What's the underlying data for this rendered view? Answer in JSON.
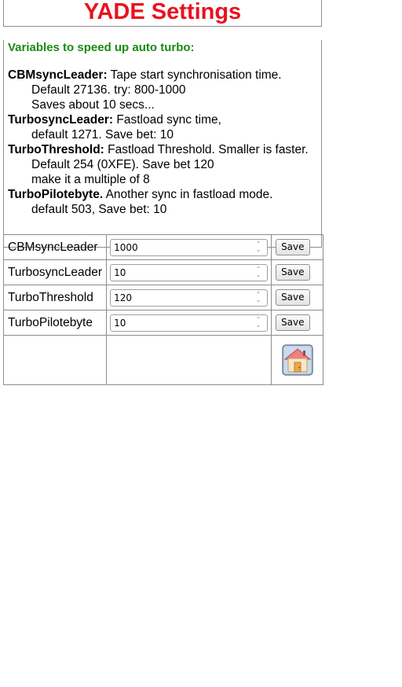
{
  "title": "YADE Settings",
  "subtitle": "Variables to speed up auto turbo:",
  "descriptions": [
    {
      "name": "CBMsyncLeader:",
      "text": " Tape start synchronisation time.",
      "lines": [
        "Default 27136. try: 800-1000",
        "Saves about 10 secs..."
      ]
    },
    {
      "name": "TurbosyncLeader:",
      "text": " Fastload sync time,",
      "lines": [
        "default 1271. Save bet: 10"
      ]
    },
    {
      "name": "TurboThreshold:",
      "text": " Fastload Threshold. Smaller is faster.",
      "lines": [
        "Default 254 (0XFE). Save bet 120",
        "make it a multiple of 8"
      ]
    },
    {
      "name": "TurboPilotebyte.",
      "text": " Another sync in fastload mode.",
      "lines": [
        "default 503, Save bet: 10"
      ]
    }
  ],
  "params": [
    {
      "label": "CBMsyncLeader",
      "value": "1000",
      "button": "Save"
    },
    {
      "label": "TurbosyncLeader",
      "value": "10",
      "button": "Save"
    },
    {
      "label": "TurboThreshold",
      "value": "120",
      "button": "Save"
    },
    {
      "label": "TurboPilotebyte",
      "value": "10",
      "button": "Save"
    }
  ],
  "home_icon": "home-icon",
  "colors": {
    "title": "#e8121f",
    "subtitle": "#1a8a13",
    "border": "#8c8c8c"
  }
}
